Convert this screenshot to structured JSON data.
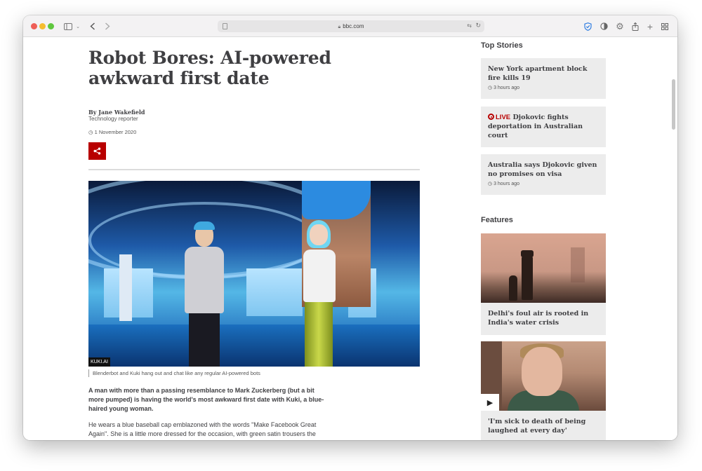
{
  "browser": {
    "url": "bbc.com"
  },
  "article": {
    "headline": "Robot Bores: AI-powered awkward first date",
    "author": "By Jane Wakefield",
    "role": "Technology reporter",
    "date": "1 November 2020",
    "image_credit": "KUKI.AI",
    "caption": "Blenderbot and Kuki hang out and chat like any regular AI-powered bots",
    "lead": "A man with more than a passing resemblance to Mark Zuckerberg (but a bit more pumped) is having the world's most awkward first date with Kuki, a blue-haired young woman.",
    "paragraph": "He wears a blue baseball cap emblazoned with the words \"Make Facebook Great Again\". She is a little more dressed for the occasion, with green satin trousers the highlight of her outfit."
  },
  "sidebar": {
    "top_stories_title": "Top Stories",
    "stories": [
      {
        "title": "New York apartment block fire kills 19",
        "time": "3 hours ago"
      },
      {
        "live": "LIVE",
        "title": "Djokovic fights deportation in Australian court"
      },
      {
        "title": "Australia says Djokovic given no promises on visa",
        "time": "3 hours ago"
      }
    ],
    "features_title": "Features",
    "features": [
      {
        "title": "Delhi's foul air is rooted in India's water crisis"
      },
      {
        "title": "'I'm sick to death of being laughed at every day'"
      }
    ]
  },
  "icons": {
    "sidebar_toggle": "sidebar-icon",
    "back": "chevron-left-icon",
    "forward": "chevron-right-icon",
    "lock": "lock-icon",
    "share": "share-icon",
    "clock": "clock-icon",
    "play": "play-icon"
  },
  "colors": {
    "bbc_red": "#b80000",
    "text": "#3f3f42",
    "card_bg": "#ececec"
  }
}
